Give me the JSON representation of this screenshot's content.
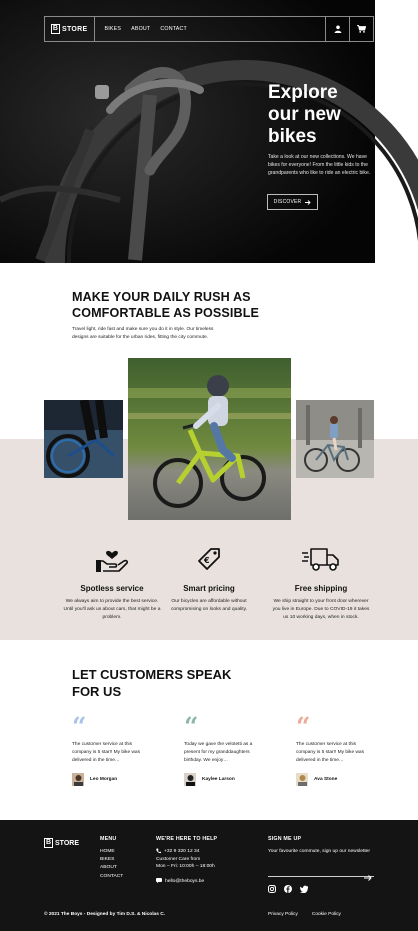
{
  "nav": {
    "logo_letter": "B",
    "logo_text": "STORE",
    "links": [
      "BIKES",
      "ABOUT",
      "CONTACT"
    ],
    "icons": [
      "user-icon",
      "cart-icon"
    ]
  },
  "hero": {
    "title_lines": [
      "Explore",
      "our new",
      "bikes"
    ],
    "text": "Take a look at our new collections. We have bikes for everyone! From the little kids to the grandparents who like to ride an electric bike.",
    "cta_label": "DISCOVER"
  },
  "intro": {
    "title": "MAKE YOUR DAILY RUSH AS COMFORTABLE AS POSSIBLE",
    "text": "Travel light, ride fast and make sure you do it in style. Our timeless designs are suitable for the urban rides, fitting the city commute."
  },
  "features": [
    {
      "icon": "hand-heart-icon",
      "title": "Spotless service",
      "text": "We always aim to provide the best service. Until you'll ask us about cars, that might be a problem."
    },
    {
      "icon": "price-tag-icon",
      "title": "Smart pricing",
      "text": "Our bicycles are affordable without compromising on looks and quality."
    },
    {
      "icon": "delivery-truck-icon",
      "title": "Free shipping",
      "text": "We ship straight to your front door wherever you live in Europe. Due to COVID-19 it takes us 10 working days, when in stock."
    }
  ],
  "testimonials": {
    "title": "LET CUSTOMERS SPEAK FOR US",
    "reviews": [
      {
        "quote_color": "#a9c3e8",
        "text": "The customer service at this company is 5 star!! My bike was delivered in the time…",
        "name": "Leo Morgan"
      },
      {
        "quote_color": "#8fb8a3",
        "text": "Today we gave the velotetti as a present for my granddaughters birthday. We enjoy…",
        "name": "Kaylee Larson"
      },
      {
        "quote_color": "#eeaa98",
        "text": "The customer service at this company is 5 star!! My bike was delivered in the time…",
        "name": "Ava Stone"
      }
    ]
  },
  "footer": {
    "logo_letter": "B",
    "logo_text": "STORE",
    "menu_title": "MENU",
    "menu_items": [
      "HOME",
      "BIKES",
      "ABOUT",
      "CONTACT"
    ],
    "help_title": "WE'RE HERE TO HELP",
    "phone": "+32 9 320 12 34",
    "care_line1": "Customer Care from",
    "care_line2": "Mon – Fri: 10:00h – 18:00h",
    "email": "hello@theboys.be",
    "signup_title": "SIGN ME UP",
    "signup_text": "Your favourite commute, sign up our newsletter",
    "social_icons": [
      "instagram-icon",
      "facebook-icon",
      "twitter-icon"
    ],
    "copyright": "© 2021 The Boys - Designed by Tim D.S. & Nicolas C.",
    "privacy": "Privacy Policy",
    "cookie": "Cookie Policy"
  },
  "colors": {
    "hero_bg": "#0b0b0b",
    "beige_band": "#e8e1dd",
    "footer_bg": "#141414"
  }
}
